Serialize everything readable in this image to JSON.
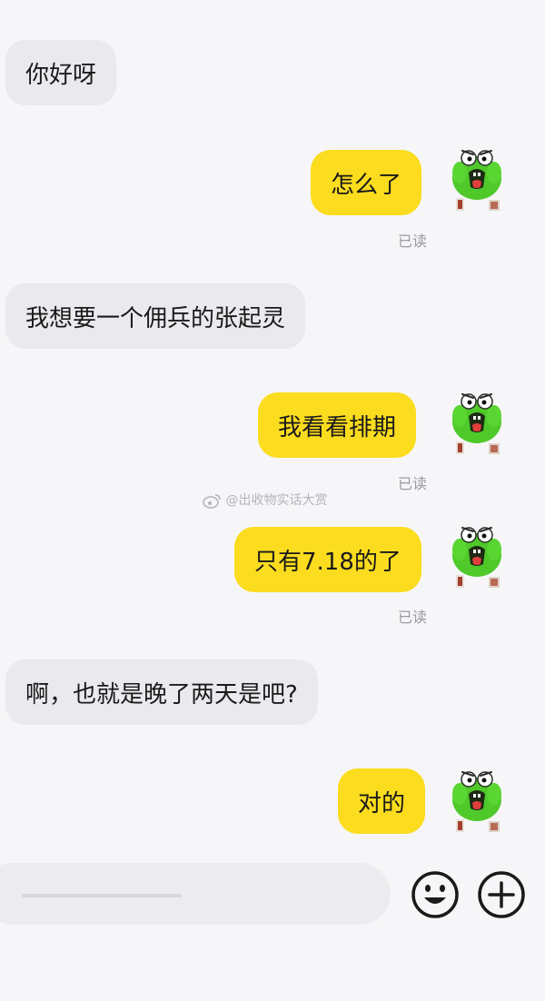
{
  "messages": [
    {
      "side": "in",
      "text": "你好呀"
    },
    {
      "side": "out",
      "text": "怎么了",
      "read": "已读"
    },
    {
      "side": "in",
      "text": "我想要一个佣兵的张起灵"
    },
    {
      "side": "out",
      "text": "我看看排期",
      "read": "已读"
    },
    {
      "side": "out",
      "text": "只有7.18的了",
      "read": "已读"
    },
    {
      "side": "in",
      "text": "啊，也就是晚了两天是吧?"
    },
    {
      "side": "out",
      "text": "对的"
    }
  ],
  "watermark": "@出收物实话大赏",
  "input": {
    "placeholder": ""
  },
  "icons": {
    "avatar": "green-frog-avatar-icon",
    "emoji_button": "smile-emoji-icon",
    "plus_button": "plus-circle-icon",
    "watermark_logo": "weibo-logo-icon"
  },
  "colors": {
    "outgoing_bubble": "#fbdc1e",
    "incoming_bubble": "#eaeaee",
    "background": "#f6f6f8",
    "read_text": "#9a9aa0",
    "avatar_green": "#4fc92a"
  }
}
